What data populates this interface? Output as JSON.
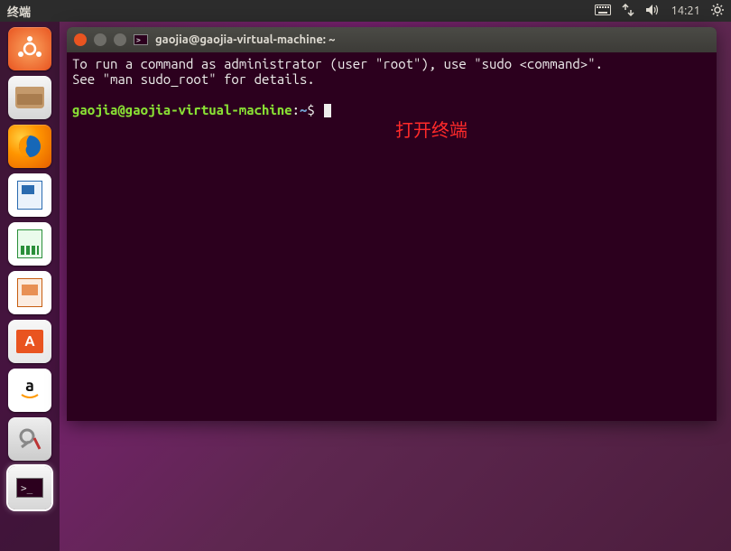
{
  "menubar": {
    "title": "终端",
    "time": "14:21"
  },
  "launcher": {
    "items": [
      {
        "name": "dash",
        "label": "Dash"
      },
      {
        "name": "files",
        "label": "Files"
      },
      {
        "name": "firefox",
        "label": "Firefox"
      },
      {
        "name": "writer",
        "label": "LibreOffice Writer"
      },
      {
        "name": "calc",
        "label": "LibreOffice Calc"
      },
      {
        "name": "impress",
        "label": "LibreOffice Impress"
      },
      {
        "name": "software",
        "label": "Ubuntu Software"
      },
      {
        "name": "amazon",
        "label": "Amazon"
      },
      {
        "name": "settings",
        "label": "System Settings"
      },
      {
        "name": "terminal",
        "label": "Terminal"
      }
    ]
  },
  "window": {
    "title": "gaojia@gaojia-virtual-machine: ~"
  },
  "terminal": {
    "motd_line1": "To run a command as administrator (user \"root\"), use \"sudo <command>\".",
    "motd_line2": "See \"man sudo_root\" for details.",
    "prompt_userhost": "gaojia@gaojia-virtual-machine",
    "prompt_sep": ":",
    "prompt_path": "~",
    "prompt_symbol": "$"
  },
  "annotation": {
    "text": "打开终端"
  }
}
